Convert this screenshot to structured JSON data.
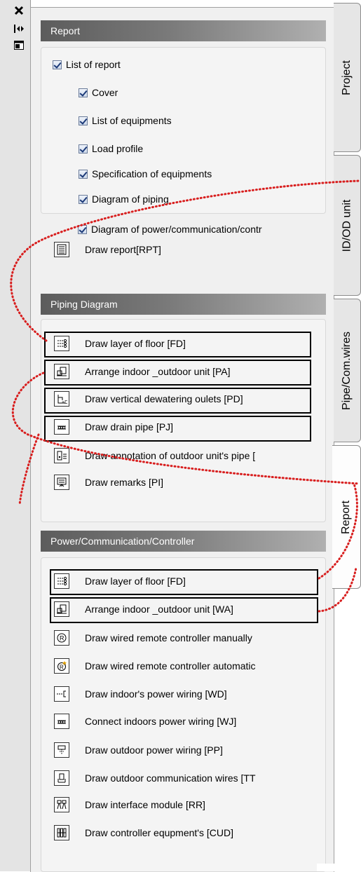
{
  "toolbar": {
    "close_icon": "close-icon",
    "dock_icon": "dock-toggle-icon",
    "properties_icon": "properties-icon"
  },
  "report_section": {
    "header": "Report",
    "parent_checkbox": {
      "label": "List of report",
      "checked": true
    },
    "checkboxes": [
      {
        "label": "Cover",
        "checked": true
      },
      {
        "label": "List of equipments",
        "checked": true
      },
      {
        "label": "Load profile",
        "checked": true
      },
      {
        "label": "Specification of equipments",
        "checked": true
      },
      {
        "label": "Diagram of piping",
        "checked": true
      },
      {
        "label": "Diagram of power/communication/contr",
        "checked": true
      }
    ],
    "draw_report": {
      "label": "Draw report[RPT]",
      "icon": "report-icon"
    }
  },
  "piping_section": {
    "header": "Piping Diagram",
    "items": [
      {
        "label": "Draw layer of floor [FD]",
        "icon": "floor-layer-icon"
      },
      {
        "label": "Arrange indoor _outdoor unit [PA]",
        "icon": "arrange-unit-icon"
      },
      {
        "label": "Draw vertical dewatering oulets [PD]",
        "icon": "dewatering-icon"
      },
      {
        "label": "Draw drain pipe [PJ]",
        "icon": "drain-pipe-icon"
      },
      {
        "label": "Draw annotation of outdoor unit's pipe [",
        "icon": "annotation-icon"
      },
      {
        "label": "Draw remarks [PI]",
        "icon": "remarks-icon"
      }
    ]
  },
  "power_section": {
    "header": "Power/Communication/Controller",
    "items": [
      {
        "label": "Draw layer of floor [FD]",
        "icon": "floor-layer-icon"
      },
      {
        "label": "Arrange indoor _outdoor unit [WA]",
        "icon": "arrange-unit-icon"
      },
      {
        "label": "Draw wired remote controller manually",
        "icon": "remote-controller-icon"
      },
      {
        "label": "Draw wired remote controller automatic",
        "icon": "remote-controller-auto-icon"
      },
      {
        "label": "Draw indoor's power wiring [WD]",
        "icon": "indoor-power-wiring-icon"
      },
      {
        "label": "Connect indoors power wiring [WJ]",
        "icon": "connect-wiring-icon"
      },
      {
        "label": "Draw outdoor power wiring [PP]",
        "icon": "outdoor-power-icon"
      },
      {
        "label": "Draw outdoor communication wires [TT",
        "icon": "communication-wires-icon"
      },
      {
        "label": "Draw interface module [RR]",
        "icon": "interface-module-icon"
      },
      {
        "label": "Draw controller equpment's [CUD]",
        "icon": "controller-equipment-icon"
      }
    ]
  },
  "tabs": [
    {
      "label": "Project",
      "active": false
    },
    {
      "label": "ID/OD unit",
      "active": false
    },
    {
      "label": "Pipe/Com.wires",
      "active": false
    },
    {
      "label": "Report",
      "active": true
    }
  ],
  "annotation_color": "#d81e1e"
}
